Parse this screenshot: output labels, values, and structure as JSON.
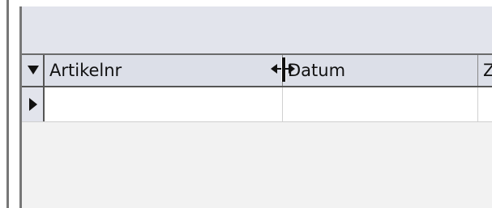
{
  "grid": {
    "columns": [
      {
        "label": "Artikelnr"
      },
      {
        "label": "Datum"
      },
      {
        "label": "Z"
      }
    ],
    "rows": [
      {
        "cells": [
          "",
          "",
          ""
        ]
      }
    ]
  },
  "icons": {
    "corner": "dropdown-triangle-icon",
    "row_selector": "current-row-arrow-icon",
    "cursor": "column-resize-cursor-icon"
  },
  "colors": {
    "header_band": "#e2e4ec",
    "column_header": "#dcdfe8",
    "grid_background": "#f2f2f2"
  }
}
